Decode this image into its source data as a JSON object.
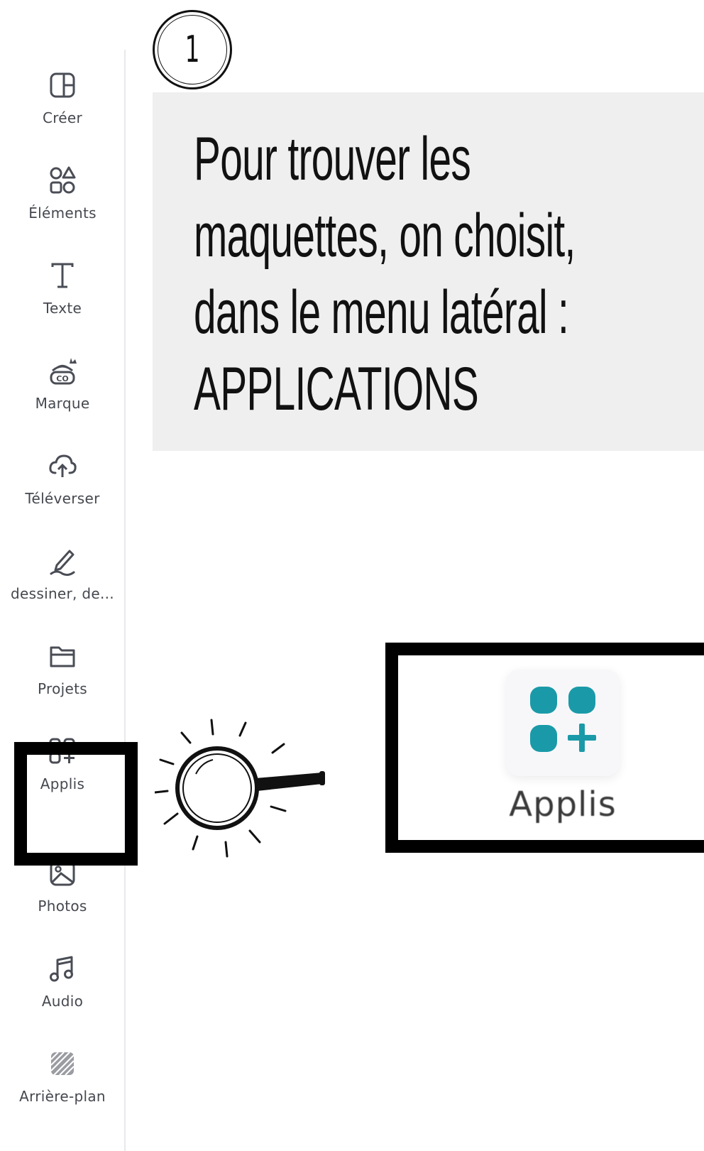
{
  "step": {
    "number": "1"
  },
  "instruction": {
    "text": "Pour trouver les\nmaquettes, on choisit,\ndans le menu latéral :\nAPPLICATIONS"
  },
  "sidebar": {
    "items": [
      {
        "label": "Créer",
        "icon": "create-icon"
      },
      {
        "label": "Éléments",
        "icon": "elements-icon"
      },
      {
        "label": "Texte",
        "icon": "text-icon"
      },
      {
        "label": "Marque",
        "icon": "brand-icon"
      },
      {
        "label": "Téléverser",
        "icon": "upload-icon"
      },
      {
        "label": "dessiner, de...",
        "icon": "draw-icon"
      },
      {
        "label": "Projets",
        "icon": "folder-icon"
      },
      {
        "label": "Applis",
        "icon": "apps-icon",
        "highlighted": true
      },
      {
        "label": "Photos",
        "icon": "photo-icon"
      },
      {
        "label": "Audio",
        "icon": "music-icon"
      },
      {
        "label": "Arrière-plan",
        "icon": "background-icon"
      }
    ]
  },
  "zoom": {
    "label": "Applis",
    "icon": "apps-icon",
    "icon_color": "#1a9aa8"
  },
  "colors": {
    "highlight_border": "#000000",
    "instruction_background": "#efefef",
    "sidebar_text": "#45484f"
  }
}
